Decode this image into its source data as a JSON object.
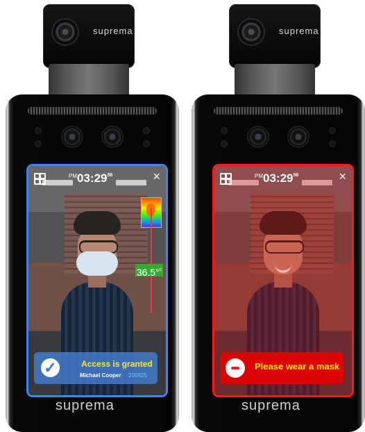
{
  "devices": [
    {
      "brand_top": "suprema",
      "time_period": "PM",
      "time": "03:29",
      "seconds": "56",
      "temperature": "36.5°",
      "message": "Access is granted",
      "user_name": "Michael Cooper",
      "user_id": "200825",
      "brand_bottom": "suprema"
    },
    {
      "brand_top": "suprema",
      "time_period": "PM",
      "time": "03:29",
      "seconds": "56",
      "message": "Please wear a mask",
      "brand_bottom": "suprema"
    }
  ],
  "icons": {
    "grid": "grid-icon",
    "close": "close-icon",
    "check": "check-circle-icon",
    "mask_warning": "mask-warning-icon"
  },
  "colors": {
    "access_blue": "#3d86f0",
    "warning_red": "#ff1616",
    "granted_text": "#ffe233",
    "id_blue": "#6cc2ff",
    "temp_green": "#38a834"
  }
}
